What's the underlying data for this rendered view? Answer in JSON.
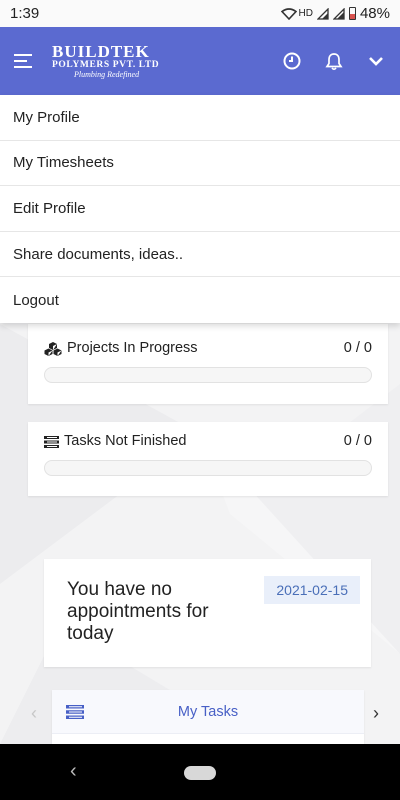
{
  "status_bar": {
    "time": "1:39",
    "network": "HD",
    "battery_percent": "48%",
    "icons": [
      "wifi-icon",
      "signal-icon",
      "signal-icon",
      "battery-icon"
    ]
  },
  "header": {
    "logo": {
      "name": "BUILDTEK",
      "subtitle": "POLYMERS PVT. LTD",
      "tagline": "Plumbing Redefined"
    },
    "icons": [
      "menu-icon",
      "clock-icon",
      "bell-icon",
      "chevron-down-icon"
    ],
    "background": "#5b6ad0"
  },
  "menu": {
    "items": [
      {
        "label": "My Profile"
      },
      {
        "label": "My Timesheets"
      },
      {
        "label": "Edit Profile"
      },
      {
        "label": "Share documents, ideas.."
      },
      {
        "label": "Logout"
      }
    ]
  },
  "dashboard": {
    "projects": {
      "icon": "cubes-icon",
      "label": "Projects In Progress",
      "count": "0 / 0",
      "progress": 0
    },
    "tasks": {
      "icon": "list-icon",
      "label": "Tasks Not Finished",
      "count": "0 / 0",
      "progress": 0
    }
  },
  "appointments": {
    "message": "You have no appointments for today",
    "date": "2021-02-15"
  },
  "my_tasks": {
    "icon": "list-icon",
    "label": "My Tasks",
    "arrows": [
      "chevron-left-icon",
      "chevron-right-icon"
    ]
  },
  "system_nav": {
    "icons": [
      "back-icon",
      "home-pill-icon"
    ]
  },
  "colors": {
    "accent": "#5b6ad0",
    "date_badge_bg": "#e9effa",
    "date_badge_text": "#4a6fb8",
    "tasks_label": "#4860c6"
  }
}
